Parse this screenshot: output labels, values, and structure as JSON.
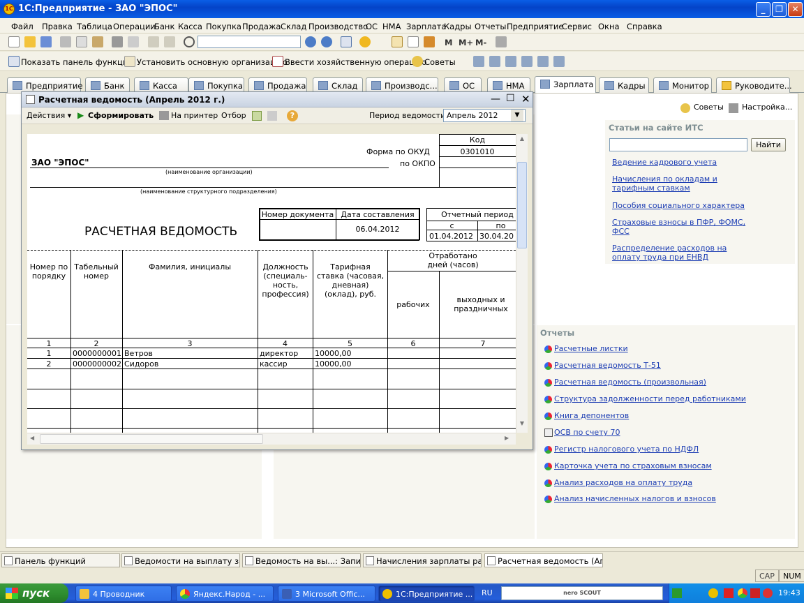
{
  "window": {
    "title": "1С:Предприятие - ЗАО \"ЭПОС\""
  },
  "menu": [
    "Файл",
    "Правка",
    "Таблица",
    "Операции",
    "Банк",
    "Касса",
    "Покупка",
    "Продажа",
    "Склад",
    "Производство",
    "ОС",
    "НМА",
    "Зарплата",
    "Кадры",
    "Отчеты",
    "Предприятие",
    "Сервис",
    "Окна",
    "Справка"
  ],
  "toolbar2": {
    "show_panel": "Показать панель функций",
    "set_org": "Установить основную организацию",
    "enter_op": "Ввести хозяйственную операцию",
    "tips": "Советы"
  },
  "tabs": [
    "Предприятие",
    "Банк",
    "Касса",
    "Покупка",
    "Продажа",
    "Склад",
    "Производс...",
    "ОС",
    "НМА",
    "Зарплата",
    "Кадры",
    "Монитор",
    "Руководите..."
  ],
  "right_panel": {
    "tips": "Советы",
    "settings": "Настройка...",
    "its_title": "Статьи на сайте ИТС",
    "find": "Найти",
    "its_links": [
      "Ведение кадрового учета",
      "Начисления по окладам и тарифным ставкам",
      "Пособия социального характера",
      "Страховые взносы в ПФР, ФОМС, ФСС",
      "Распределение расходов на оплату труда при ЕНВД"
    ],
    "reports_title": "Отчеты",
    "reports": [
      "Расчетные листки",
      "Расчетная ведомость Т-51",
      "Расчетная ведомость (произвольная)",
      "Структура задолженности перед работниками",
      "Книга депонентов",
      "ОСВ по счету 70",
      "Регистр налогового учета по НДФЛ",
      "Карточка учета по страховым взносам",
      "Анализ расходов на оплату труда",
      "Анализ начисленных налогов и взносов"
    ]
  },
  "dialog": {
    "title": "Расчетная ведомость (Апрель 2012 г.)",
    "actions": "Действия",
    "form": "Сформировать",
    "print": "На принтер",
    "filter": "Отбор",
    "period_label": "Период ведомости:",
    "period_value": "Апрель 2012"
  },
  "sheet": {
    "code": "Код",
    "okud_label": "Форма по ОКУД",
    "okud": "0301010",
    "okpo_label": "по ОКПО",
    "org": "ЗАО \"ЭПОС\"",
    "org_caption": "(наименование организации)",
    "unit_caption": "(наименование структурного подразделения)",
    "doc_no": "Номер документа",
    "doc_date": "Дата составления",
    "date": "06.04.2012",
    "title": "РАСЧЕТНАЯ ВЕДОМОСТЬ",
    "period": "Отчетный период",
    "from": "с",
    "to": "по",
    "from_v": "01.04.2012",
    "to_v": "30.04.20",
    "col_no": "Номер по порядку",
    "col_tab": "Табельный номер",
    "col_name": "Фамилия, инициалы",
    "col_pos": "Должность (специаль-ность, профессия)",
    "col_rate": "Тарифная ставка (часовая, дневная) (оклад), руб.",
    "col_worked": "Отработано дней (часов)",
    "col_work": "рабочих",
    "col_hol": "выходных и праздничных",
    "nums": [
      "1",
      "2",
      "3",
      "4",
      "5",
      "6",
      "7"
    ],
    "rows": [
      {
        "n": "1",
        "tab": "0000000001",
        "name": "Ветров",
        "pos": "директор",
        "rate": "10000,00"
      },
      {
        "n": "2",
        "tab": "0000000002",
        "name": "Сидоров",
        "pos": "кассир",
        "rate": "10000,00"
      }
    ]
  },
  "tasks_win": [
    "Панель функций",
    "Ведомости на выплату зар...",
    "Ведомость на вы...: Записан",
    "Начисления зарплаты рабо...",
    "Расчетная ведомость (Апр..."
  ],
  "status": {
    "cap": "CAP",
    "num": "NUM"
  },
  "taskbar": {
    "start": "пуск",
    "items": [
      "4 Проводник",
      "Яндекс.Народ - ...",
      "3 Microsoft Offic...",
      "1С:Предприятие ..."
    ],
    "lang": "RU",
    "search": "nero SCOUT",
    "time": "19:43"
  }
}
